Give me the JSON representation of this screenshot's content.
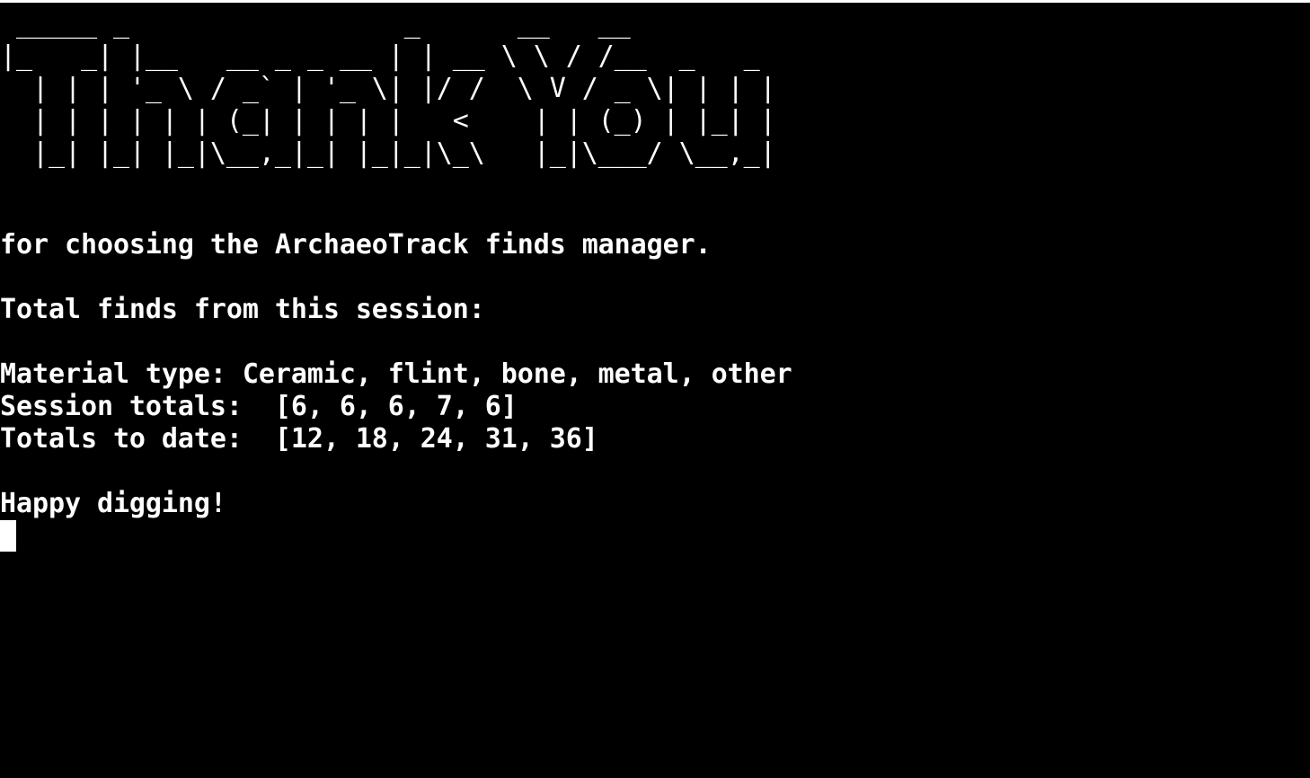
{
  "terminal": {
    "banner_lines": [
      " _____ _                 _      __   __",
      "|_   _| |__   __ _ _ __ | | __ \\ \\ / /__  _   _",
      "  | | | '_ \\ / _` | '_ \\| |/ /  \\ V / _ \\| | | |",
      "  | | | | | | (_| | | | |   <    | | (_) | |_| |",
      "  |_| |_| |_|\\__,_|_| |_|_|\\_\\   |_|\\___/ \\__,_|"
    ],
    "thanks_line": "for choosing the ArchaeoTrack finds manager.",
    "session_header": "Total finds from this session:",
    "material_line": "Material type: Ceramic, flint, bone, metal, other",
    "session_totals_line": "Session totals:  [6, 6, 6, 7, 6]",
    "totals_to_date_line": "Totals to date:  [12, 18, 24, 31, 36]",
    "farewell_line": "Happy digging!"
  },
  "colors": {
    "background": "#000000",
    "text": "#ffffff",
    "frame": "#ffffff"
  }
}
